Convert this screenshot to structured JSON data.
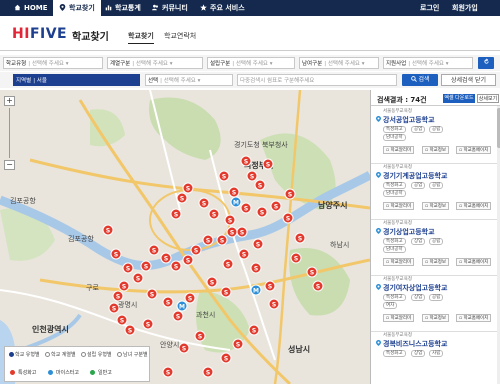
{
  "topnav": {
    "home": "HOME",
    "school_search": "학교찾기",
    "school_stats": "학교통계",
    "community": "커뮤니티",
    "main_services": "주요 서비스",
    "login": "로그인",
    "signup": "회원가입",
    "bg_color": "#14294d"
  },
  "logo": {
    "part1": "HI",
    "part2": "FIVE"
  },
  "page_title": "학교찾기",
  "subtabs": {
    "school_search": "학교찾기",
    "school_contact": "학교연락처"
  },
  "filters": {
    "school_type": {
      "label": "학교유형",
      "placeholder": "선택해 주세요"
    },
    "establish_type": {
      "label": "계열구분",
      "placeholder": "선택해 주세요"
    },
    "founding_type": {
      "label": "설립구분",
      "placeholder": "선택해 주세요"
    },
    "gender_type": {
      "label": "남여구분",
      "placeholder": "선택해 주세요"
    },
    "region_type": {
      "label": "지원사업",
      "placeholder": "선택해 주세요"
    },
    "region": {
      "label": "지역별",
      "value": "서울"
    },
    "select": {
      "label": "선택",
      "placeholder": "선택해 주세요"
    },
    "keyword": {
      "placeholder": "다중검색시 쉼표로 구분해주세요"
    },
    "search_button": "검색",
    "detail_close_button": "상세검색 닫기"
  },
  "map": {
    "labels": [
      "경기도청 북부청사",
      "의정부시",
      "남양주시",
      "김포공항",
      "김포공항",
      "구로",
      "광명시",
      "인천광역시",
      "과천시",
      "성남시",
      "안양시",
      "하남시"
    ],
    "zoom_in": "+",
    "zoom_out": "−"
  },
  "legend": {
    "options": [
      "학교 유형별",
      "학교 계열별",
      "설립 유형별",
      "남녀 구분별"
    ],
    "selected_option": "학교 유형별",
    "keys": [
      {
        "label": "특성화고",
        "color": "#e23b2e"
      },
      {
        "label": "마이스터고",
        "color": "#2e8fd6"
      },
      {
        "label": "일반고",
        "color": "#2aa64c"
      }
    ]
  },
  "results": {
    "title": "검색결과 : 74건",
    "excel_button": "엑셀 다운로드",
    "detail_button": "상세보기",
    "cards": [
      {
        "district": "서울동부교육청",
        "name": "강서공업고등학교",
        "tags": [
          "특성화고",
          "공업",
          "공립",
          "남녀공학"
        ],
        "buttons": [
          "학교알리미",
          "학교정보",
          "학교홈페이지"
        ]
      },
      {
        "district": "서울동부교육청",
        "name": "경기기계공업고등학교",
        "tags": [
          "특성화고",
          "공업",
          "공립",
          "남녀공학"
        ],
        "buttons": [
          "학교알리미",
          "학교정보",
          "학교홈페이지"
        ]
      },
      {
        "district": "서울동부교육청",
        "name": "경기상업고등학교",
        "tags": [
          "특성화고",
          "상업",
          "공립",
          "남녀공학"
        ],
        "buttons": [
          "학교알리미",
          "학교정보",
          "학교홈페이지"
        ]
      },
      {
        "district": "서울동부교육청",
        "name": "경기여자상업고등학교",
        "tags": [
          "특성화고",
          "상업",
          "공립",
          "여자"
        ],
        "buttons": [
          "학교알리미",
          "학교정보",
          "학교홈페이지"
        ]
      },
      {
        "district": "서울동부교육청",
        "name": "경복비즈니스고등학교",
        "tags": [
          "특성화고",
          "상업",
          "사립"
        ],
        "buttons": []
      }
    ]
  },
  "map_marker_letter": "S",
  "map_marker_letter_m": "M"
}
